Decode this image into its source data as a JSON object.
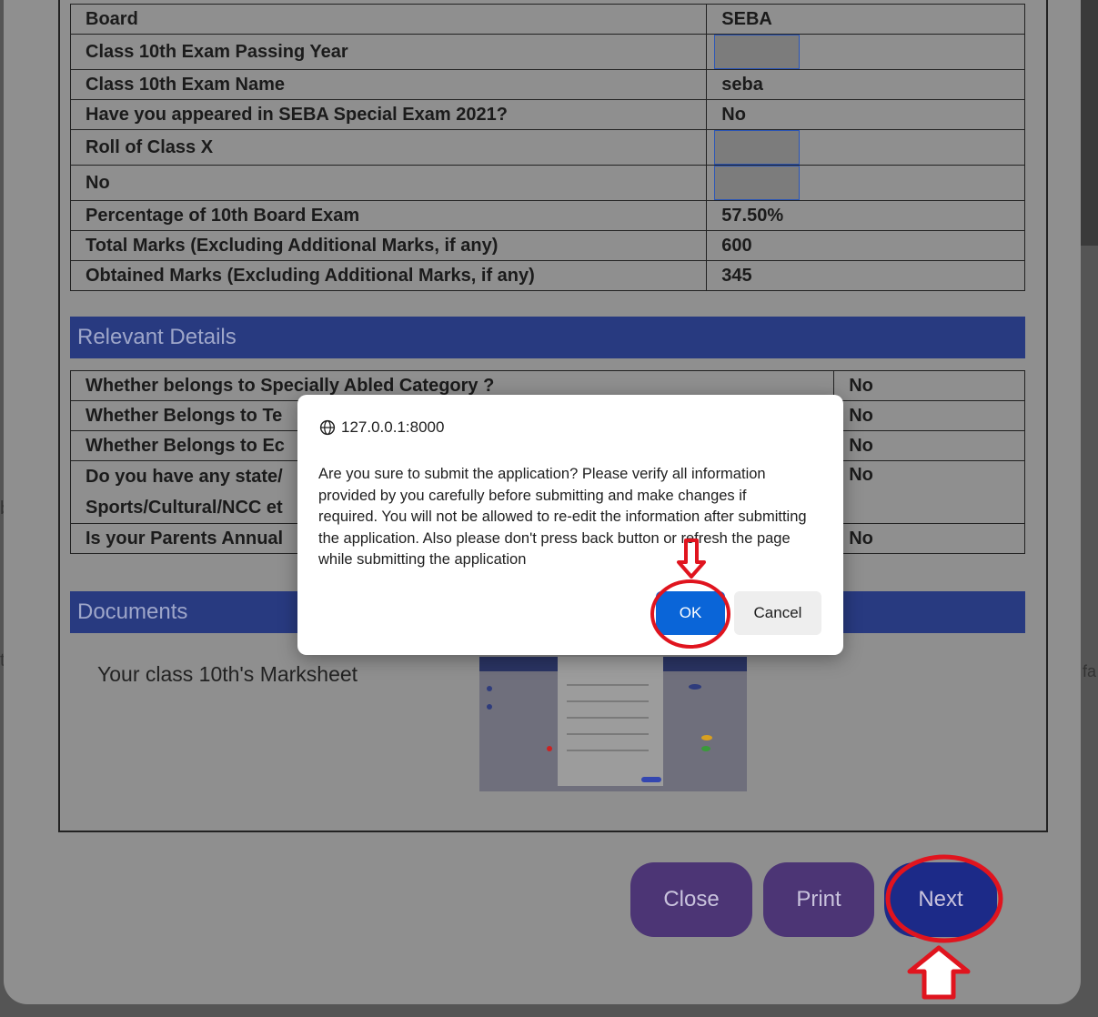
{
  "background_fragments": {
    "left_b": "b",
    "left_t": "t",
    "right_fa": "fa"
  },
  "academic_table": {
    "rows": [
      {
        "label": "Board",
        "value": "SEBA",
        "redacted": false
      },
      {
        "label": "Class 10th Exam Passing Year",
        "value": "",
        "redacted": true
      },
      {
        "label": "Class 10th Exam Name",
        "value": "seba",
        "redacted": false
      },
      {
        "label": "Have you appeared in SEBA Special Exam 2021?",
        "value": "No",
        "redacted": false
      },
      {
        "label": "Roll of Class X",
        "value": "",
        "redacted": true
      },
      {
        "label": "No",
        "value": "",
        "redacted": true
      },
      {
        "label": "Percentage of 10th Board Exam",
        "value": "57.50%",
        "redacted": false
      },
      {
        "label": "Total Marks (Excluding Additional Marks, if any)",
        "value": "600",
        "redacted": false
      },
      {
        "label": "Obtained Marks (Excluding Additional Marks, if any)",
        "value": "345",
        "redacted": false
      }
    ]
  },
  "relevant_details": {
    "title": "Relevant Details",
    "rows": [
      {
        "label": "Whether belongs to Specially Abled Category ?",
        "value": "No"
      },
      {
        "label": "Whether Belongs to Te",
        "value": "No"
      },
      {
        "label": "Whether Belongs to Ec",
        "value": "No"
      },
      {
        "label": "Do you have any state/",
        "label2": "Sports/Cultural/NCC et",
        "value": "No"
      },
      {
        "label": "Is your Parents Annual",
        "value": "No"
      }
    ]
  },
  "documents": {
    "title": "Documents",
    "marksheet_label": "Your class 10th's Marksheet"
  },
  "buttons": {
    "close": "Close",
    "print": "Print",
    "next": "Next"
  },
  "dialog": {
    "origin": "127.0.0.1:8000",
    "message": "Are you sure to submit the application? Please verify all information provided by you carefully before submitting and make changes if required. You will not be allowed to re-edit the information after submitting the application. Also please don't press back button or refresh the page while submitting the application",
    "ok_label": "OK",
    "cancel_label": "Cancel"
  },
  "colors": {
    "section_bar": "#283a80",
    "close_print_button": "#4c3575",
    "next_button": "#1c2a88",
    "ok_button": "#0a65d8",
    "annotation_red": "#e0141e"
  },
  "annotations": {
    "ok_circle": "red-circle-around-ok",
    "next_circle": "red-circle-around-next",
    "down_arrow": "red-arrow-down-to-ok",
    "up_arrow": "red-arrow-up-to-next"
  }
}
